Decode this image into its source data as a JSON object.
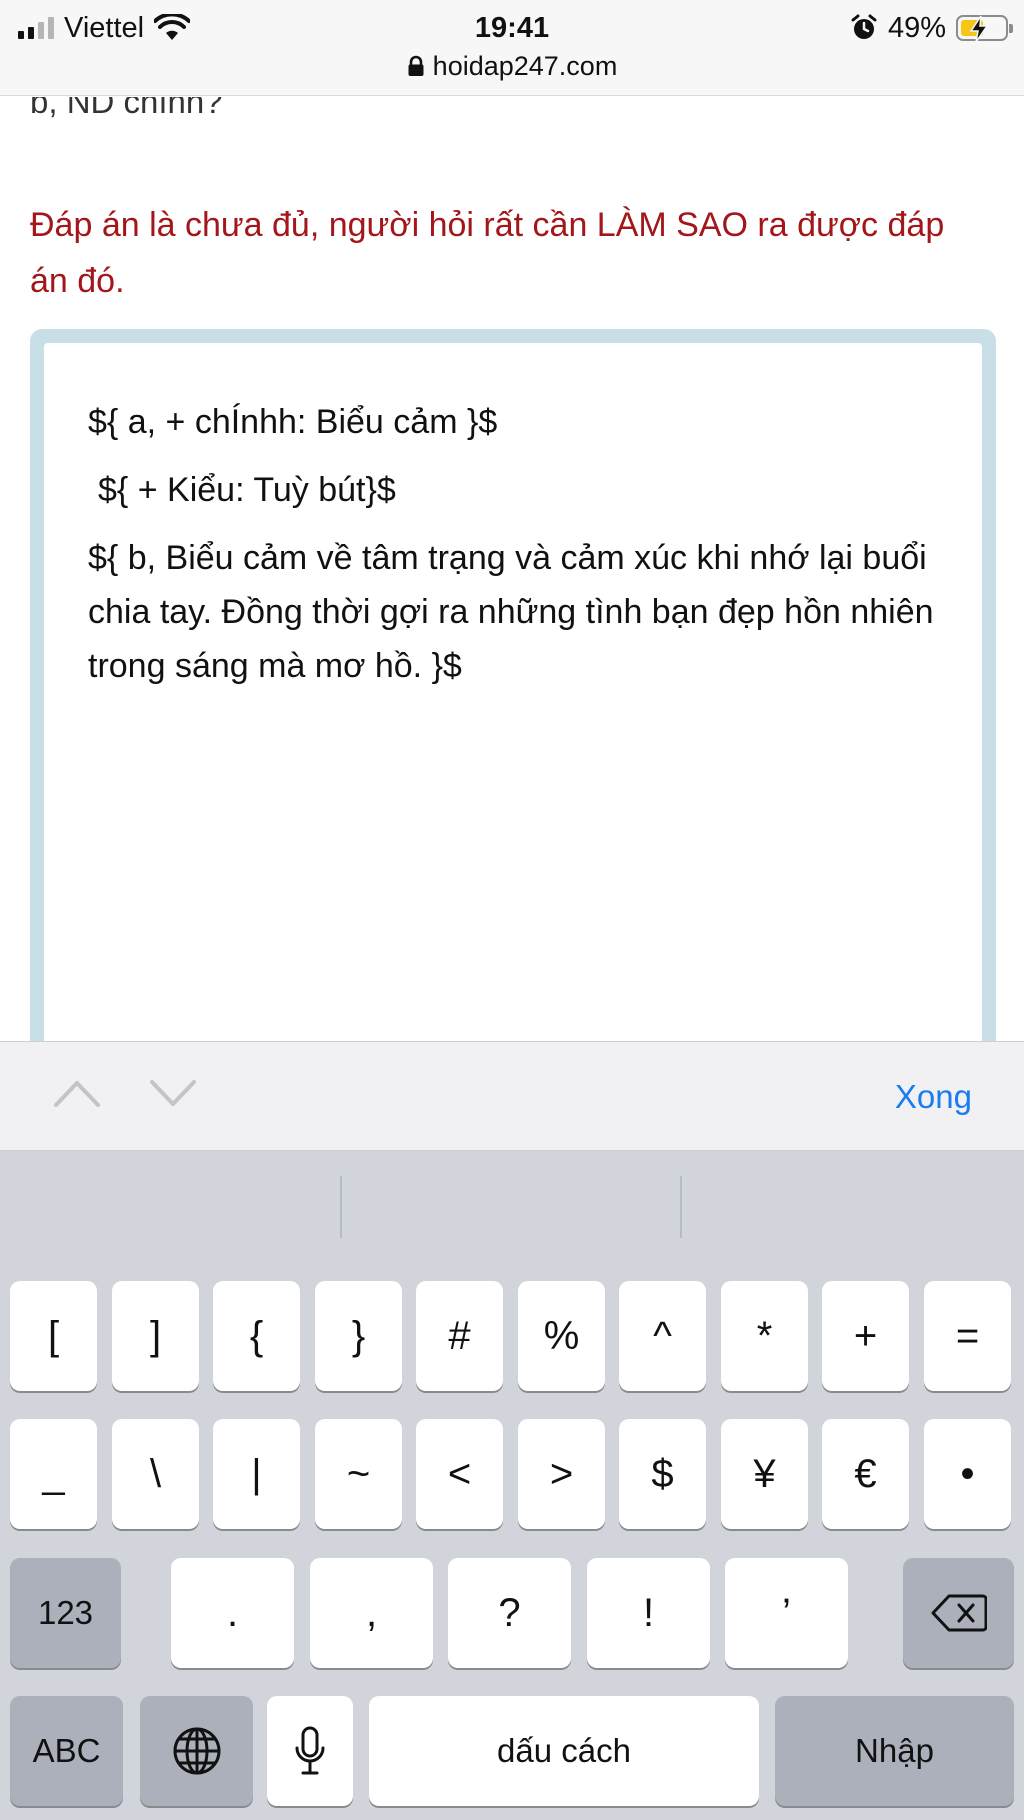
{
  "status_bar": {
    "carrier": "Viettel",
    "time": "19:41",
    "battery_percent": "49%",
    "battery_level": 0.49,
    "url": "hoidap247.com",
    "icons": [
      "signal-icon",
      "wifi-icon",
      "alarm-icon",
      "battery-charging-icon",
      "lock-icon"
    ]
  },
  "content": {
    "prev_line": "b, ND chính?",
    "notice": "Đáp án là chưa đủ, người hỏi rất cần LÀM SAO ra được đáp án đó.",
    "notice_color": "#a3161a",
    "editor_lines": [
      "${ a, + chÍnhh: Biểu cảm }$",
      "${  + Kiểu: Tuỳ bút}$",
      "${ b, Biểu cảm về tâm trạng và cảm xúc khi nhớ lại buổi chia tay. Đồng thời gợi ra những tình bạn đẹp hồn nhiên trong sáng mà mơ hồ. }$"
    ]
  },
  "accessory": {
    "done_label": "Xong",
    "done_color": "#1a7cf0",
    "icons": [
      "chevron-up-icon",
      "chevron-down-icon"
    ]
  },
  "keyboard": {
    "row1": [
      "[",
      "]",
      "{",
      "}",
      "#",
      "%",
      "^",
      "*",
      "+",
      "="
    ],
    "row2": [
      "_",
      "\\",
      "|",
      "~",
      "<",
      ">",
      "$",
      "¥",
      "€",
      "•"
    ],
    "row3_mode": "123",
    "row3": [
      ".",
      ",",
      "?",
      "!",
      "’"
    ],
    "row4_abc": "ABC",
    "space_label": "dấu cách",
    "return_label": "Nhập",
    "icons": [
      "backspace-icon",
      "globe-icon",
      "microphone-icon"
    ]
  }
}
